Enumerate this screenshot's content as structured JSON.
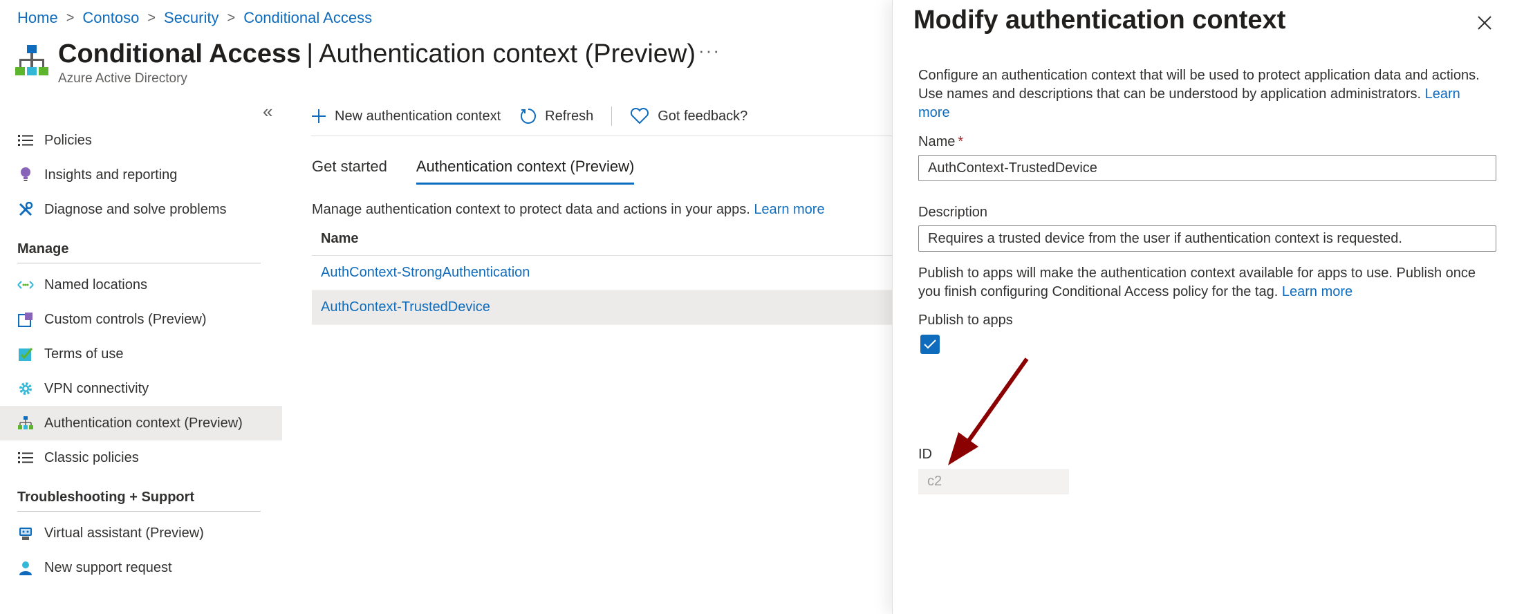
{
  "breadcrumb": [
    "Home",
    "Contoso",
    "Security",
    "Conditional Access"
  ],
  "header": {
    "title_bold": "Conditional Access",
    "title_separator": "|",
    "title_rest": "Authentication context (Preview)",
    "subtitle": "Azure Active Directory",
    "more": "···"
  },
  "sidebar": {
    "collapse": "«",
    "items_top": [
      {
        "label": "Policies",
        "icon": "list-icon"
      },
      {
        "label": "Insights and reporting",
        "icon": "lightbulb-icon"
      },
      {
        "label": "Diagnose and solve problems",
        "icon": "wrench-icon"
      }
    ],
    "manage_heading": "Manage",
    "manage_items": [
      {
        "label": "Named locations",
        "icon": "location-arrows-icon"
      },
      {
        "label": "Custom controls (Preview)",
        "icon": "custom-controls-icon"
      },
      {
        "label": "Terms of use",
        "icon": "checklist-icon"
      },
      {
        "label": "VPN connectivity",
        "icon": "gear-icon"
      },
      {
        "label": "Authentication context (Preview)",
        "icon": "hierarchy-icon",
        "active": true
      },
      {
        "label": "Classic policies",
        "icon": "list-icon"
      }
    ],
    "support_heading": "Troubleshooting + Support",
    "support_items": [
      {
        "label": "Virtual assistant (Preview)",
        "icon": "bot-icon"
      },
      {
        "label": "New support request",
        "icon": "person-icon"
      }
    ]
  },
  "toolbar": {
    "new_label": "New authentication context",
    "refresh_label": "Refresh",
    "feedback_label": "Got feedback?"
  },
  "tabs": [
    {
      "label": "Get started",
      "selected": false
    },
    {
      "label": "Authentication context (Preview)",
      "selected": true
    }
  ],
  "main": {
    "description": "Manage authentication context to protect data and actions in your apps.",
    "learn_more": "Learn more",
    "table_header": "Name",
    "rows": [
      "AuthContext-StrongAuthentication",
      "AuthContext-TrustedDevice"
    ],
    "selected_row": 1
  },
  "panel": {
    "title": "Modify authentication context",
    "description": "Configure an authentication context that will be used to protect application data and actions. Use names and descriptions that can be understood by application administrators.",
    "learn_more": "Learn more",
    "name_label": "Name",
    "required_mark": "*",
    "name_value": "AuthContext-TrustedDevice",
    "description_label": "Description",
    "description_value": "Requires a trusted device from the user if authentication context is requested.",
    "publish_description": "Publish to apps will make the authentication context available for apps to use. Publish once you finish configuring Conditional Access policy for the tag.",
    "publish_learn_more": "Learn more",
    "publish_label": "Publish to apps",
    "publish_checked": true,
    "id_label": "ID",
    "id_value": "c2"
  },
  "colors": {
    "accent": "#0f6cbd",
    "annotation_arrow": "#8b0000",
    "selected_bg": "#edebe9"
  }
}
